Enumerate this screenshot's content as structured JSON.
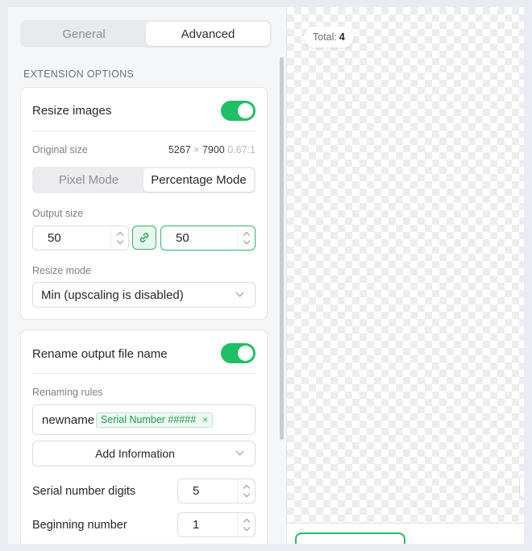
{
  "tabs": {
    "general": "General",
    "advanced": "Advanced"
  },
  "section": {
    "extension_options": "EXTENSION OPTIONS"
  },
  "resize": {
    "title": "Resize images",
    "enabled": true,
    "original_size_label": "Original size",
    "original_width": "5267",
    "times": "×",
    "original_height": "7900",
    "ratio": "0.67:1",
    "modes": {
      "pixel": "Pixel Mode",
      "percentage": "Percentage Mode"
    },
    "active_mode": "percentage",
    "output_size_label": "Output size",
    "output_width": "50",
    "output_height": "50",
    "resize_mode_label": "Resize mode",
    "resize_mode_value": "Min (upscaling is disabled)"
  },
  "rename": {
    "title": "Rename output file name",
    "enabled": true,
    "rules_label": "Renaming rules",
    "rules_prefix": "newname",
    "rules_tag": "Serial Number #####",
    "tag_remove": "×",
    "add_information": "Add Information",
    "serial_digits_label": "Serial number digits",
    "serial_digits_value": "5",
    "beginning_number_label": "Beginning number",
    "beginning_number_value": "1"
  },
  "preview": {
    "total_label": "Total:",
    "total_count": "4"
  },
  "colors": {
    "accent": "#1fbf66",
    "border_focus": "#31b46b"
  }
}
